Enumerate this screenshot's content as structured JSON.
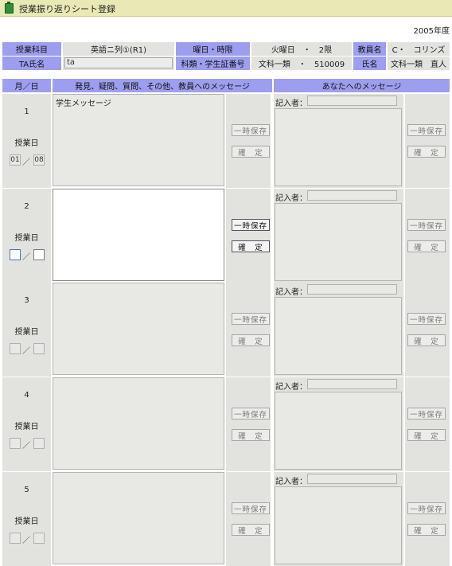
{
  "page_title": "授業振り返りシート登録",
  "year": "2005年度",
  "info": {
    "subject_label": "授業科目",
    "subject_value": "英語ニ列①(R1)",
    "dayperiod_label": "曜日・時限",
    "day_value": "火曜日　・　2限",
    "teacher_label": "教員名",
    "teacher_value": "C・　コリンズ",
    "ta_label": "TA氏名",
    "ta_value": "ta",
    "category_label": "科類・学生証番号",
    "category_value": "文科一類　・　510009",
    "name_label": "氏名",
    "name_value": "文科一類　直人"
  },
  "columns": {
    "date": "月／日",
    "student_message": "発見、疑問、質問、その他、教員へのメッセージ",
    "reply": "あなたへのメッセージ"
  },
  "labels": {
    "class_date": "授業日",
    "slash": "／",
    "save_temp": "一時保存",
    "confirm": "確　定",
    "writer": "記入者："
  },
  "rows": [
    {
      "number": "1",
      "month": "01",
      "day": "08",
      "message": "学生メッセージ"
    },
    {
      "number": "2",
      "month": "",
      "day": "",
      "message": ""
    },
    {
      "number": "3",
      "month": "",
      "day": "",
      "message": ""
    },
    {
      "number": "4",
      "month": "",
      "day": "",
      "message": ""
    },
    {
      "number": "5",
      "month": "",
      "day": "",
      "message": ""
    }
  ]
}
